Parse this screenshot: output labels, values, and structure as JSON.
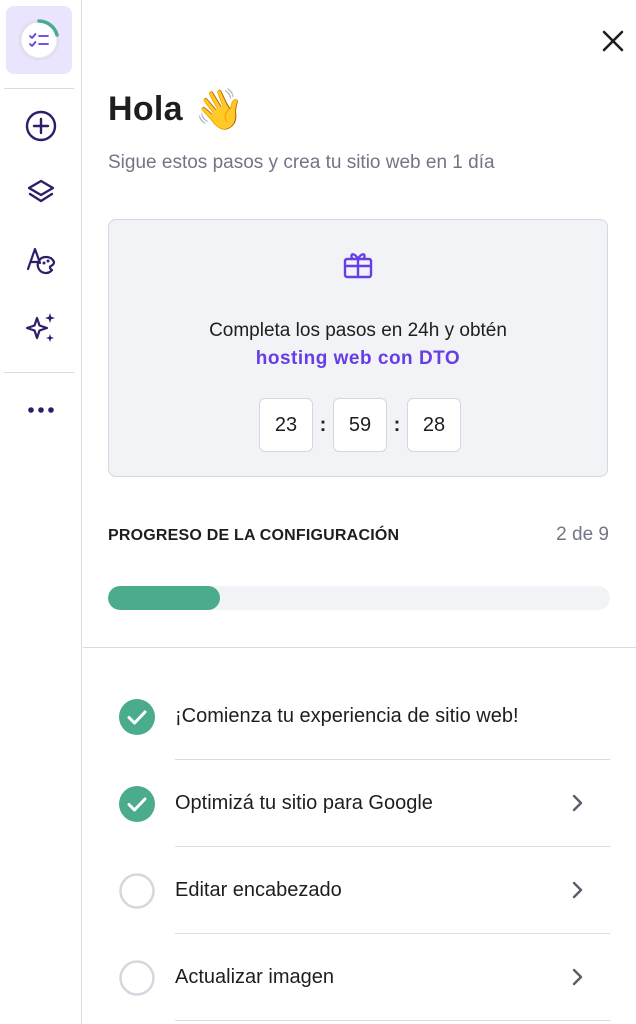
{
  "greeting": {
    "title": "Hola",
    "emoji": "👋",
    "subtitle": "Sigue estos pasos y crea tu sitio web en 1 día"
  },
  "promo": {
    "line1": "Completa los pasos en 24h y obtén",
    "line2": "hosting web con DTO",
    "timer": {
      "hours": "23",
      "minutes": "59",
      "seconds": "28",
      "separator": ":"
    }
  },
  "progress": {
    "label": "PROGRESO DE LA CONFIGURACIÓN",
    "count_text": "2 de 9",
    "completed": 2,
    "total": 9
  },
  "steps": [
    {
      "label": "¡Comienza tu experiencia de sitio web!",
      "done": true,
      "has_chevron": false
    },
    {
      "label": "Optimizá tu sitio para Google",
      "done": true,
      "has_chevron": true
    },
    {
      "label": "Editar encabezado",
      "done": false,
      "has_chevron": true
    },
    {
      "label": "Actualizar imagen",
      "done": false,
      "has_chevron": true
    }
  ],
  "sidebar": {
    "icons": [
      "progress-checklist-icon",
      "add-icon",
      "layers-icon",
      "styles-palette-icon",
      "ai-sparkles-icon",
      "more-icon"
    ]
  },
  "colors": {
    "accent": "#673de6",
    "success": "#4aab8d",
    "tile_bg": "#ebe4ff"
  }
}
